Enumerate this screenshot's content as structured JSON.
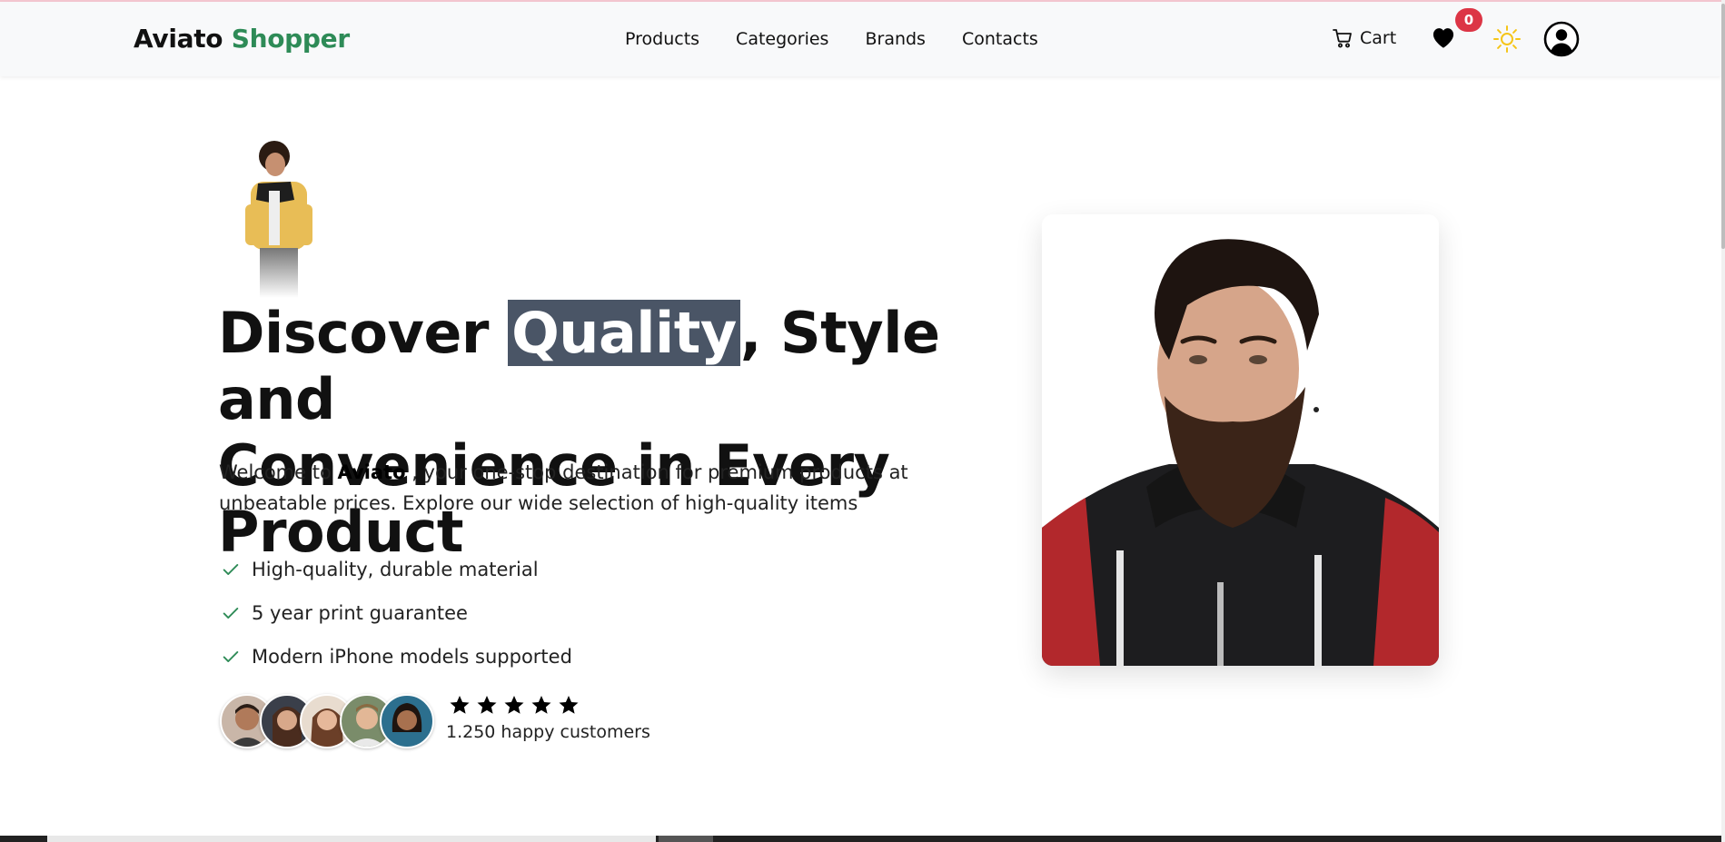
{
  "brand": {
    "part1": "Aviato",
    "part2": "Shopper",
    "accent_color": "#2e8b57"
  },
  "nav": {
    "items": [
      {
        "label": "Products"
      },
      {
        "label": "Categories"
      },
      {
        "label": "Brands"
      },
      {
        "label": "Contacts"
      }
    ]
  },
  "header": {
    "cart_label": "Cart",
    "wishlist_count": "0",
    "icons": [
      "cart-icon",
      "heart-icon",
      "sun-icon",
      "user-icon"
    ],
    "badge_color": "#dc3545",
    "sun_color": "#f5c518"
  },
  "hero": {
    "title_before": "Discover ",
    "title_highlight": "Quality",
    "title_line1_after": ", Style and",
    "title_line2": "Convenience in Every Product",
    "desc_prefix": "Welcome to ",
    "desc_brand": "Aviato",
    "desc_rest": " , your one-stop destination for premium products at unbeatable prices. Explore our wide selection of high-quality items",
    "features": [
      "High-quality, durable material",
      "5 year print guarantee",
      "Modern iPhone models supported"
    ],
    "rating_stars": 5,
    "customers_text": "1.250 happy customers"
  }
}
